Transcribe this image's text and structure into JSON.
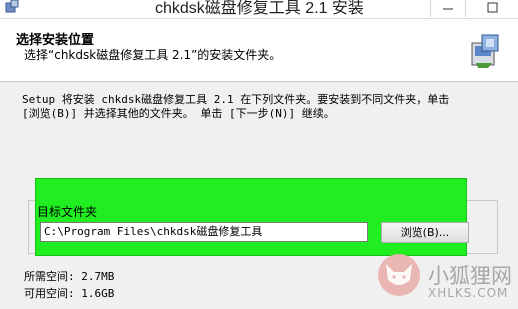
{
  "window": {
    "title": "chkdsk磁盘修复工具 2.1 安装"
  },
  "header": {
    "title": "选择安装位置",
    "subtitle": "选择“chkdsk磁盘修复工具 2.1”的安装文件夹。"
  },
  "description": {
    "line1": "Setup 将安装 chkdsk磁盘修复工具 2.1 在下列文件夹。要安装到不同文件夹，单击",
    "line2": "[浏览(B)] 并选择其他的文件夹。 单击 [下一步(N)] 继续。"
  },
  "destination": {
    "group_label": "目标文件夹",
    "path_value": "C:\\Program Files\\chkdsk磁盘修复工具",
    "browse_label": "浏览(B)..."
  },
  "space": {
    "required": "所需空间: 2.7MB",
    "available": "可用空间: 1.6GB"
  },
  "watermark": {
    "title": "小狐狸网",
    "subtitle": "XHLKS.COM"
  },
  "colors": {
    "highlight": "#20ee20",
    "header_bg": "#ffffff",
    "dialog_bg": "#f0f0f0"
  },
  "icons": [
    "installer-app-icon",
    "minimize-icon",
    "maximize-icon",
    "installer-header-icon",
    "fox-watermark-icon"
  ]
}
